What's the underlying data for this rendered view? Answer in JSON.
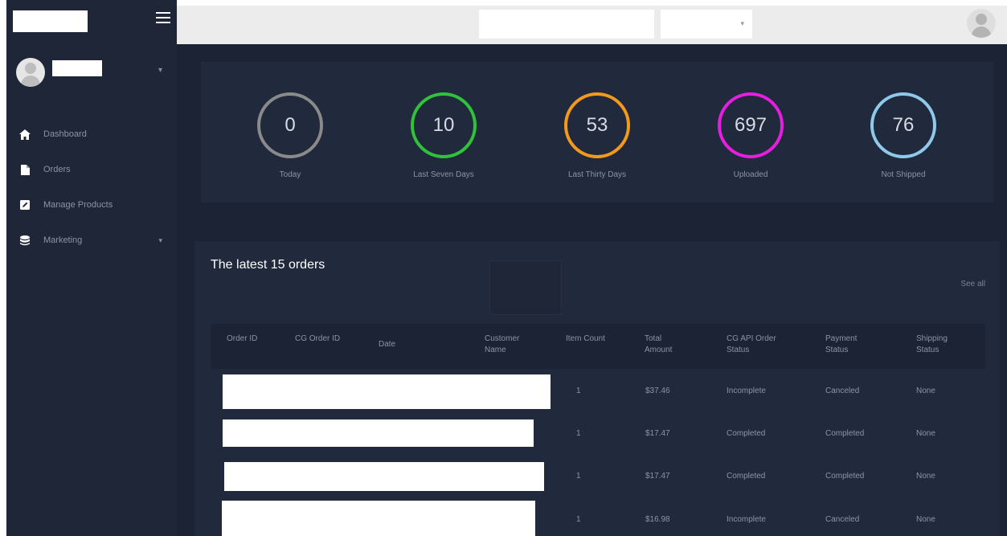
{
  "sidebar": {
    "nav": [
      {
        "label": "Dashboard",
        "icon": "home-icon"
      },
      {
        "label": "Orders",
        "icon": "file-icon"
      },
      {
        "label": "Manage Products",
        "icon": "edit-icon"
      },
      {
        "label": "Marketing",
        "icon": "database-icon"
      }
    ]
  },
  "stats": [
    {
      "value": "0",
      "label": "Today",
      "color": "#8a8a8a"
    },
    {
      "value": "10",
      "label": "Last Seven Days",
      "color": "#2fc23a"
    },
    {
      "value": "53",
      "label": "Last Thirty Days",
      "color": "#f39a1c"
    },
    {
      "value": "697",
      "label": "Uploaded",
      "color": "#e51ee0"
    },
    {
      "value": "76",
      "label": "Not Shipped",
      "color": "#8fc9ea"
    }
  ],
  "orders": {
    "title": "The latest 15 orders",
    "see_all": "See all",
    "columns": [
      "Order ID",
      "CG Order ID",
      "Date",
      "Customer Name",
      "Item Count",
      "Total Amount",
      "CG API Order Status",
      "Payment Status",
      "Shipping Status"
    ],
    "rows": [
      {
        "item_count": "1",
        "total": "$37.46",
        "cg_status": "Incomplete",
        "payment": "Canceled",
        "shipping": "None"
      },
      {
        "item_count": "1",
        "total": "$17.47",
        "cg_status": "Completed",
        "payment": "Completed",
        "shipping": "None"
      },
      {
        "item_count": "1",
        "total": "$17.47",
        "cg_status": "Completed",
        "payment": "Completed",
        "shipping": "None"
      },
      {
        "item_count": "1",
        "total": "$16.98",
        "cg_status": "Incomplete",
        "payment": "Canceled",
        "shipping": "None"
      }
    ]
  }
}
